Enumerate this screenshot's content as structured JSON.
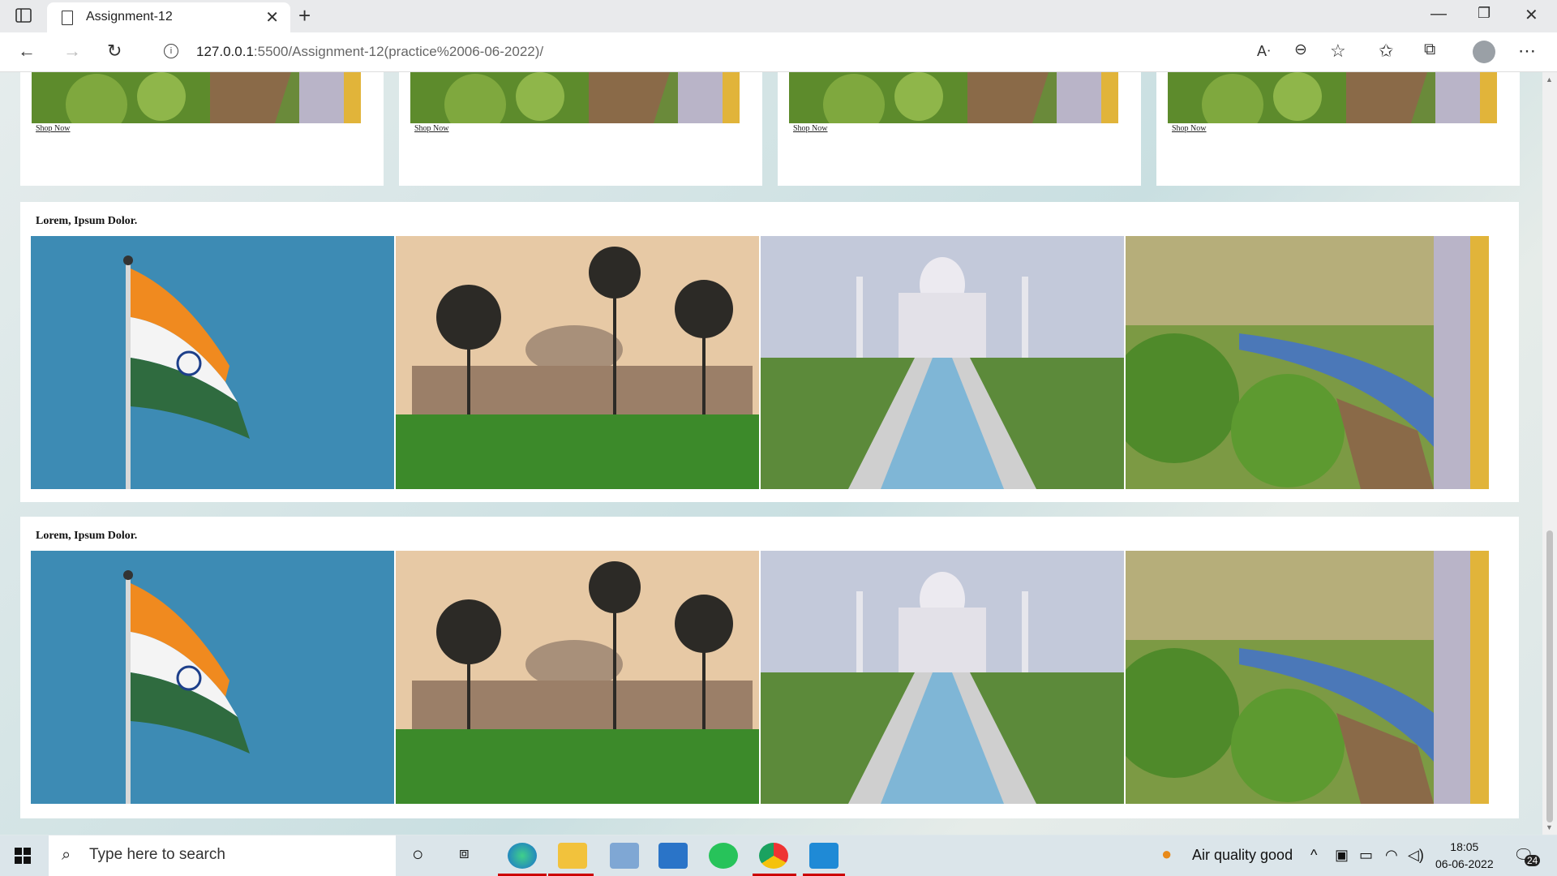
{
  "browser": {
    "tab_title": "Assignment-12",
    "url_host": "127.0.0.1",
    "url_rest": ":5500/Assignment-12(practice%2006-06-2022)/"
  },
  "cards": [
    {
      "link": "Shop Now"
    },
    {
      "link": "Shop Now"
    },
    {
      "link": "Shop Now"
    },
    {
      "link": "Shop Now"
    }
  ],
  "sections": [
    {
      "heading": "Lorem, Ipsum Dolor.",
      "images": [
        "indian-flag",
        "palace-with-palms",
        "taj-mahal",
        "train-through-hills"
      ]
    },
    {
      "heading": "Lorem, Ipsum Dolor.",
      "images": [
        "indian-flag",
        "palace-with-palms",
        "taj-mahal",
        "train-through-hills"
      ]
    }
  ],
  "taskbar": {
    "search_placeholder": "Type here to search",
    "weather": "Air quality good",
    "time": "18:05",
    "date": "06-06-2022",
    "notifications": "24"
  }
}
